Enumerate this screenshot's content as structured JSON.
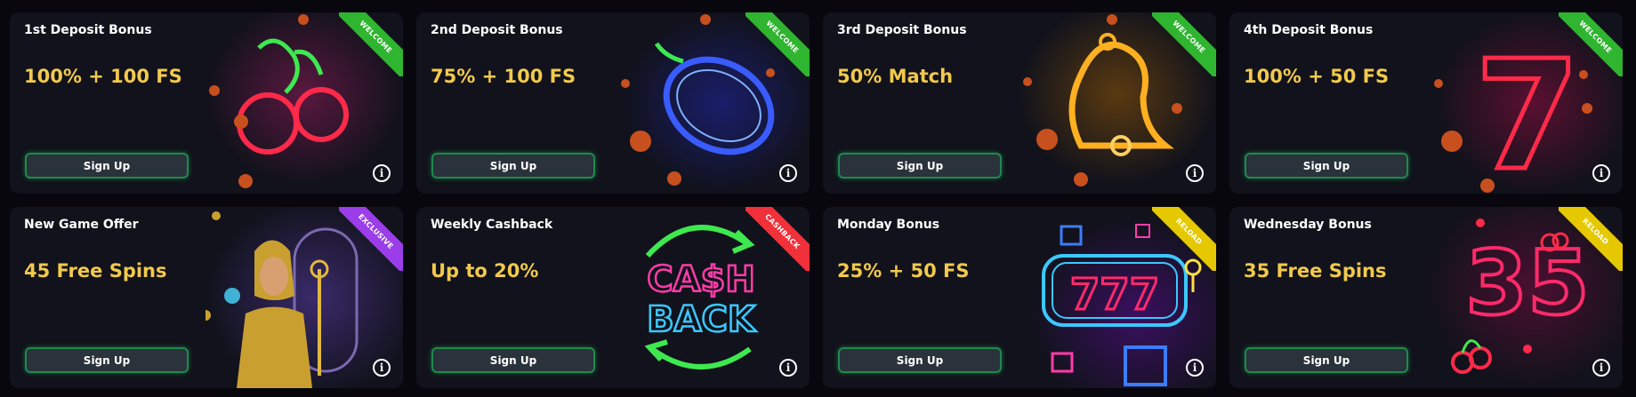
{
  "colors": {
    "background": "#07070d",
    "card": "#11121b",
    "title": "#ffffff",
    "offer": "#f2c94c",
    "button_border": "#1f8a4c",
    "ribbon_welcome": "#2fb52f",
    "ribbon_exclusive": "#9b3de8",
    "ribbon_cashback": "#f0303a",
    "ribbon_reload": "#e6c800"
  },
  "cards": [
    {
      "title": "1st Deposit Bonus",
      "offer": "100% + 100 FS",
      "button": "Sign Up",
      "ribbon": "WELCOME",
      "ribbon_color": "#2fb52f",
      "art": "neon-cherries-icon"
    },
    {
      "title": "2nd Deposit Bonus",
      "offer": "75% + 100 FS",
      "button": "Sign Up",
      "ribbon": "WELCOME",
      "ribbon_color": "#2fb52f",
      "art": "neon-plum-icon"
    },
    {
      "title": "3rd Deposit Bonus",
      "offer": "50% Match",
      "button": "Sign Up",
      "ribbon": "WELCOME",
      "ribbon_color": "#2fb52f",
      "art": "neon-bell-icon"
    },
    {
      "title": "4th Deposit Bonus",
      "offer": "100% + 50 FS",
      "button": "Sign Up",
      "ribbon": "WELCOME",
      "ribbon_color": "#2fb52f",
      "art": "neon-seven-icon"
    },
    {
      "title": "New Game Offer",
      "offer": "45 Free Spins",
      "button": "Sign Up",
      "ribbon": "EXCLUSIVE",
      "ribbon_color": "#9b3de8",
      "art": "cleopatra-icon"
    },
    {
      "title": "Weekly Cashback",
      "offer": "Up to 20%",
      "button": "Sign Up",
      "ribbon": "CASHBACK",
      "ribbon_color": "#f0303a",
      "art": "neon-cashback-icon"
    },
    {
      "title": "Monday Bonus",
      "offer": "25% + 50 FS",
      "button": "Sign Up",
      "ribbon": "RELOAD",
      "ribbon_color": "#e6c800",
      "art": "neon-777-slot-icon"
    },
    {
      "title": "Wednesday Bonus",
      "offer": "35 Free Spins",
      "button": "Sign Up",
      "ribbon": "RELOAD",
      "ribbon_color": "#e6c800",
      "art": "neon-35-icon"
    }
  ],
  "art_text": {
    "cash": "CA$H",
    "back": "BACK",
    "slot": "777",
    "number": "35",
    "seven": "7"
  },
  "info_glyph": "i"
}
